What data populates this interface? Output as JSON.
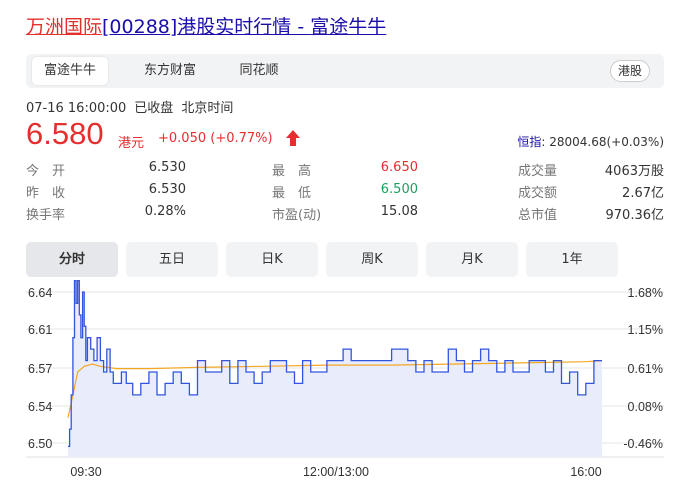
{
  "page": {
    "title_name": "万洲国际",
    "title_code": "[00288]",
    "title_rest": "港股实时行情",
    "title_sep": " - ",
    "title_source": "富途牛牛"
  },
  "source_tabs": [
    {
      "label": "富途牛牛",
      "active": true
    },
    {
      "label": "东方财富",
      "active": false
    },
    {
      "label": "同花顺",
      "active": false
    }
  ],
  "market_badge": "港股",
  "status": {
    "time": "07-16 16:00:00",
    "state": "已收盘",
    "zone": "北京时间"
  },
  "quote": {
    "price": "6.580",
    "currency": "港元",
    "change": "+0.050 (+0.77%)",
    "color_up": "#e52e2e",
    "color_down": "#19a15f"
  },
  "index": {
    "name": "恒指",
    "value": ": 28004.68(+0.03%)"
  },
  "stats": [
    [
      {
        "label": "今　开",
        "value": "6.530"
      },
      {
        "label": "最　高",
        "value": "6.650",
        "color": "up"
      },
      {
        "label": "成交量",
        "value": "4063万股"
      }
    ],
    [
      {
        "label": "昨　收",
        "value": "6.530"
      },
      {
        "label": "最　低",
        "value": "6.500",
        "color": "down"
      },
      {
        "label": "成交额",
        "value": "2.67亿"
      }
    ],
    [
      {
        "label": "换手率",
        "value": "0.28%"
      },
      {
        "label": "市盈(动)",
        "value": "15.08"
      },
      {
        "label": "总市值",
        "value": "970.36亿"
      }
    ]
  ],
  "period_tabs": [
    {
      "label": "分时",
      "active": true
    },
    {
      "label": "五日",
      "active": false
    },
    {
      "label": "日K",
      "active": false
    },
    {
      "label": "周K",
      "active": false
    },
    {
      "label": "月K",
      "active": false
    },
    {
      "label": "1年",
      "active": false
    }
  ],
  "chart_data": {
    "type": "line",
    "y_left_ticks": [
      "6.64",
      "6.61",
      "6.57",
      "6.54",
      "6.50"
    ],
    "y_right_ticks": [
      "1.68%",
      "1.15%",
      "0.61%",
      "0.08%",
      "-0.46%"
    ],
    "x_ticks": [
      "09:30",
      "12:00/13:00",
      "16:00"
    ],
    "ylim": [
      6.5,
      6.64
    ],
    "prev_close": 6.53,
    "grid": true,
    "colors": {
      "price": "#3355dd",
      "avg": "#f5a623",
      "fill": "#e8ecfb"
    },
    "series": [
      {
        "key": "price",
        "t": [
          0,
          1,
          2,
          3,
          4,
          5,
          6,
          7,
          8,
          9,
          10,
          11,
          12,
          14,
          16,
          18,
          20,
          22,
          24,
          26,
          28,
          30,
          33,
          36,
          40,
          45,
          50,
          55,
          60,
          65,
          70,
          75,
          80,
          85,
          90,
          95,
          100,
          105,
          110,
          115,
          120,
          125,
          130,
          135,
          140,
          145,
          150,
          155,
          160,
          165,
          170,
          175,
          180,
          185,
          190,
          195,
          200,
          205,
          210,
          215,
          220,
          225,
          230,
          235,
          240,
          245,
          250,
          255,
          260,
          265,
          270,
          275,
          280,
          285,
          290,
          295,
          300,
          305,
          310,
          315,
          320,
          325,
          330
        ],
        "values": [
          6.505,
          6.52,
          6.55,
          6.6,
          6.65,
          6.63,
          6.65,
          6.62,
          6.6,
          6.64,
          6.61,
          6.58,
          6.6,
          6.59,
          6.58,
          6.6,
          6.58,
          6.57,
          6.59,
          6.57,
          6.56,
          6.56,
          6.57,
          6.56,
          6.55,
          6.56,
          6.57,
          6.55,
          6.56,
          6.57,
          6.56,
          6.55,
          6.58,
          6.57,
          6.57,
          6.58,
          6.56,
          6.58,
          6.57,
          6.56,
          6.57,
          6.58,
          6.58,
          6.57,
          6.56,
          6.58,
          6.57,
          6.57,
          6.58,
          6.58,
          6.59,
          6.58,
          6.58,
          6.58,
          6.58,
          6.58,
          6.59,
          6.59,
          6.58,
          6.57,
          6.58,
          6.57,
          6.57,
          6.59,
          6.58,
          6.57,
          6.58,
          6.59,
          6.58,
          6.57,
          6.58,
          6.57,
          6.57,
          6.58,
          6.58,
          6.57,
          6.58,
          6.56,
          6.57,
          6.55,
          6.56,
          6.58,
          6.58
        ]
      },
      {
        "key": "avg",
        "t": [
          0,
          3,
          6,
          10,
          15,
          20,
          30,
          50,
          80,
          120,
          160,
          200,
          240,
          280,
          320,
          330
        ],
        "values": [
          6.53,
          6.55,
          6.57,
          6.575,
          6.577,
          6.575,
          6.573,
          6.573,
          6.574,
          6.575,
          6.576,
          6.576,
          6.577,
          6.578,
          6.579,
          6.58
        ]
      }
    ]
  }
}
